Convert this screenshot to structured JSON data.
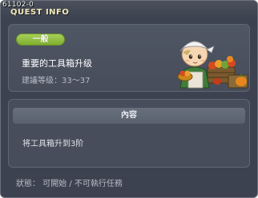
{
  "window": {
    "quest_id": "61102-0",
    "title": "QUEST INFO"
  },
  "quest": {
    "category_badge": "一般",
    "name": "重要的工具箱升级",
    "recommended_level": "建議等级：33～37"
  },
  "content": {
    "header": "內容",
    "description": "将工具箱升到3阶"
  },
  "status": {
    "text": "狀態： 可開始 / 不可執行任務"
  },
  "colors": {
    "badge": "#8fbf3e",
    "title_text": "#f2e9b8",
    "window_bg": "#3d4250"
  },
  "icons": {
    "npc": "farmer-npc-with-vegetable-crates"
  }
}
